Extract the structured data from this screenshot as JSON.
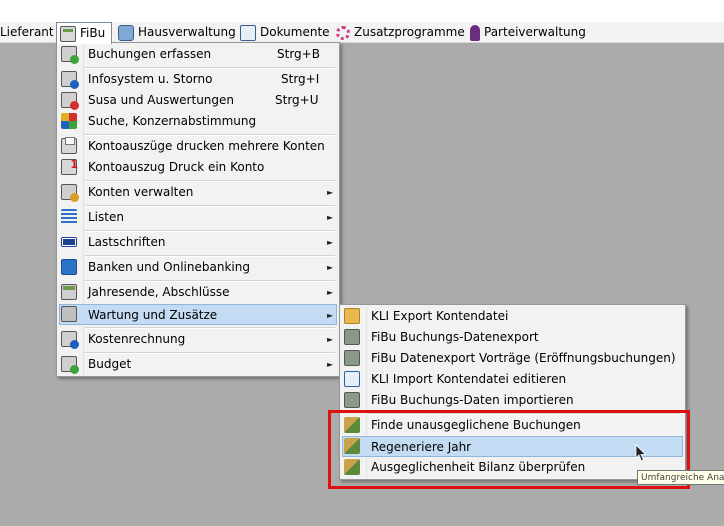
{
  "menubar": {
    "lieferant": "Lieferant",
    "fibu": "FiBu",
    "hausverwaltung": "Hausverwaltung",
    "dokumente": "Dokumente",
    "zusatzprogramme": "Zusatzprogramme",
    "parteiverwaltung": "Parteiverwaltung"
  },
  "fibu_menu": {
    "buchungen_erfassen": {
      "label": "Buchungen erfassen",
      "shortcut": "Strg+B"
    },
    "infosystem": {
      "label": "Infosystem u. Storno",
      "shortcut": "Strg+I"
    },
    "susa": {
      "label": "Susa und Auswertungen",
      "shortcut": "Strg+U"
    },
    "suche": {
      "label": "Suche, Konzernabstimmung"
    },
    "kontoauszuege_mehrere": {
      "label": "Kontoauszüge drucken mehrere Konten"
    },
    "kontoauszug_ein": {
      "label": "Kontoauszug Druck ein Konto"
    },
    "konten_verwalten": {
      "label": "Konten verwalten"
    },
    "listen": {
      "label": "Listen"
    },
    "lastschriften": {
      "label": "Lastschriften"
    },
    "banken": {
      "label": "Banken und Onlinebanking"
    },
    "jahresende": {
      "label": "Jahresende, Abschlüsse"
    },
    "wartung": {
      "label": "Wartung und Zusätze"
    },
    "kostenrechnung": {
      "label": "Kostenrechnung"
    },
    "budget": {
      "label": "Budget"
    }
  },
  "wartung_menu": {
    "kli_export": "KLI Export Kontendatei",
    "fibu_buchungs_export": "FiBu Buchungs-Datenexport",
    "fibu_vortraege": "FiBu Datenexport Vorträge (Eröffnungsbuchungen)",
    "kli_import": "KLI Import Kontendatei editieren",
    "fibu_import": "FiBu Buchungs-Daten importieren",
    "finde_unausgeglichen": "Finde unausgeglichene Buchungen",
    "regeneriere_jahr": "Regeneriere Jahr",
    "ausgeglichenheit": "Ausgeglichenheit Bilanz überprüfen"
  },
  "tooltip": "Umfangreiche Analyse",
  "icons": {
    "arrow": "right-arrow-glyph"
  },
  "colors": {
    "highlight": "#c4dcf3",
    "annotation_red": "#e01010",
    "workspace": "#ababab"
  }
}
